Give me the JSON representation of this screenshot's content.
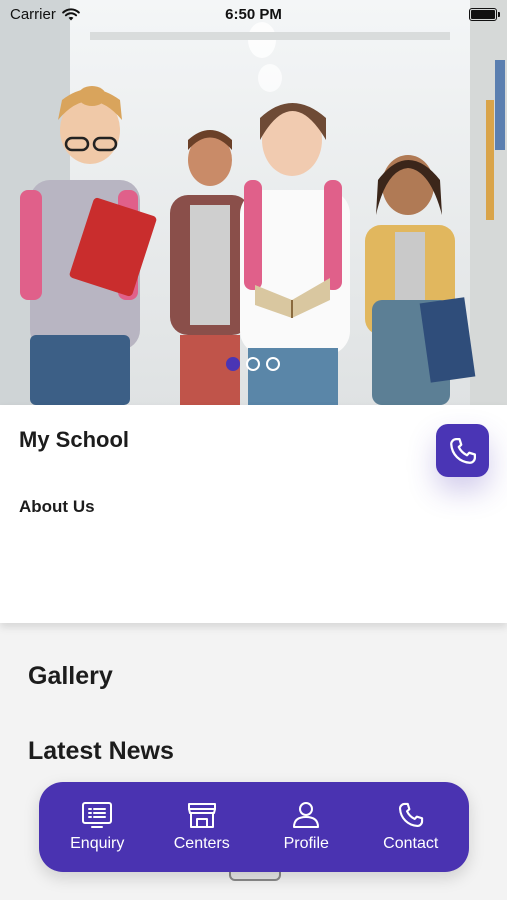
{
  "status_bar": {
    "carrier": "Carrier",
    "time": "6:50 PM"
  },
  "carousel": {
    "total_slides": 3,
    "active_slide": 1
  },
  "school": {
    "name": "My School",
    "about_label": "About Us"
  },
  "sections": {
    "gallery": "Gallery",
    "latest_news": "Latest News"
  },
  "tab_bar": {
    "items": [
      {
        "label": "Enquiry",
        "icon": "list-board-icon"
      },
      {
        "label": "Centers",
        "icon": "storefront-icon"
      },
      {
        "label": "Profile",
        "icon": "person-icon"
      },
      {
        "label": "Contact",
        "icon": "phone-icon"
      }
    ]
  },
  "colors": {
    "accent": "#4a35b5",
    "background": "#f3f3f3",
    "card": "#ffffff"
  }
}
